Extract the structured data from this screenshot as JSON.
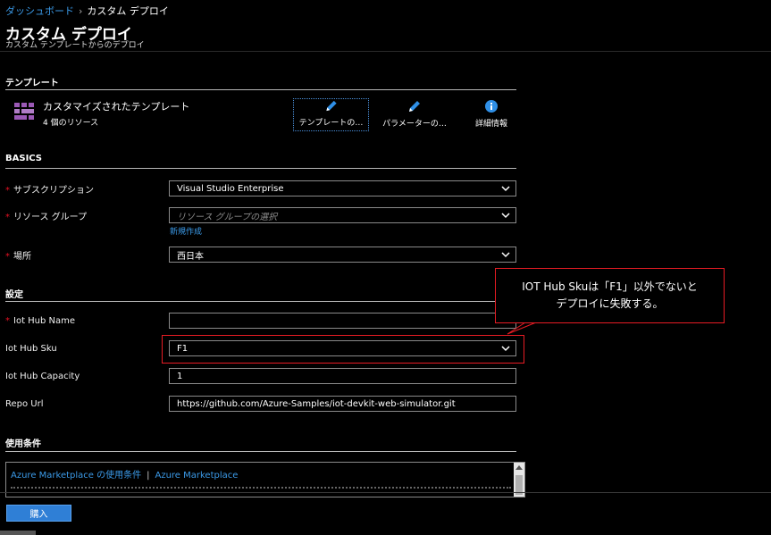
{
  "breadcrumb": {
    "home": "ダッシュボード",
    "separator": "›",
    "current": "カスタム デプロイ"
  },
  "header": {
    "title": "カスタム デプロイ",
    "subtitle": "カスタム テンプレートからのデプロイ"
  },
  "template_section": {
    "heading": "テンプレート",
    "name": "カスタマイズされたテンプレート",
    "resource_count": "4 個のリソース",
    "buttons": [
      {
        "label": "テンプレートの…",
        "icon": "pencil-icon"
      },
      {
        "label": "パラメーターの…",
        "icon": "pencil-icon"
      },
      {
        "label": "詳細情報",
        "icon": "info-icon"
      }
    ]
  },
  "basics": {
    "heading": "BASICS",
    "subscription": {
      "label": "サブスクリプション",
      "value": "Visual Studio Enterprise"
    },
    "resource_group": {
      "label": "リソース グループ",
      "placeholder": "リソース グループの選択",
      "create_new": "新規作成"
    },
    "location": {
      "label": "場所",
      "value": "西日本"
    }
  },
  "settings": {
    "heading": "設定",
    "iot_hub_name": {
      "label": "Iot Hub Name",
      "value": ""
    },
    "iot_hub_sku": {
      "label": "Iot Hub Sku",
      "value": "F1"
    },
    "iot_hub_capacity": {
      "label": "Iot Hub Capacity",
      "value": "1"
    },
    "repo_url": {
      "label": "Repo Url",
      "value": "https://github.com/Azure-Samples/iot-devkit-web-simulator.git"
    }
  },
  "callout": {
    "line1": "IOT Hub Skuは「F1」以外でないと",
    "line2": "デプロイに失敗する。"
  },
  "terms": {
    "heading": "使用条件",
    "link1": "Azure Marketplace の使用条件",
    "separator": "|",
    "link2": "Azure Marketplace"
  },
  "footer": {
    "buy_label": "購入"
  },
  "colors": {
    "accent": "#2f7fd6",
    "link": "#3b9ae8",
    "required": "#e81123",
    "callout_border": "#e81c24",
    "template_icon": "#9b59b6"
  }
}
